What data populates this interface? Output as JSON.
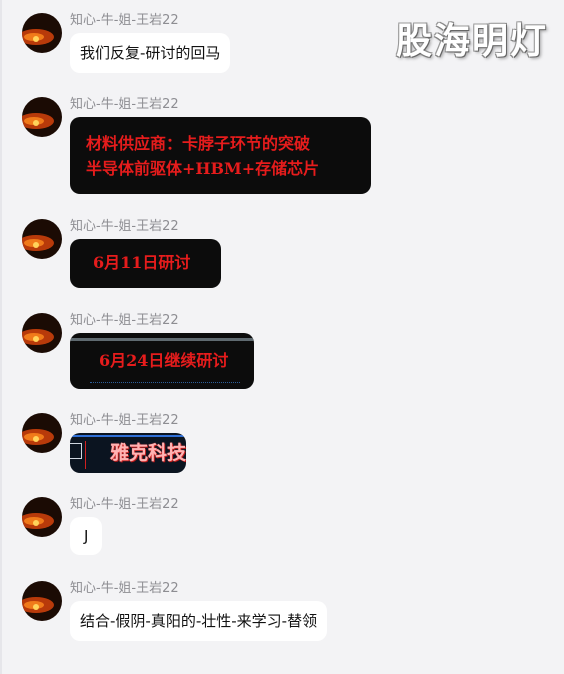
{
  "watermark": "股海明灯",
  "sender_name": "知心-牛-姐-王岩22",
  "messages": [
    {
      "type": "text",
      "text": "我们反复-研讨的回马"
    },
    {
      "type": "image",
      "lines": [
        "材料供应商：卡脖子环节的突破",
        "半导体前驱体+HBM+存储芯片"
      ]
    },
    {
      "type": "image",
      "text": "6月11日研讨"
    },
    {
      "type": "image",
      "text": "6月24日继续研讨"
    },
    {
      "type": "image",
      "text": "雅克科技"
    },
    {
      "type": "text",
      "text": "J"
    },
    {
      "type": "text",
      "text": "结合-假阴-真阳的-壮性-来学习-替领"
    }
  ],
  "colors": {
    "background": "#f3f3f5",
    "bubble": "#ffffff",
    "image_bg": "#0c0c0c",
    "red_text": "#e61c1c",
    "name_text": "#8d8d92"
  }
}
